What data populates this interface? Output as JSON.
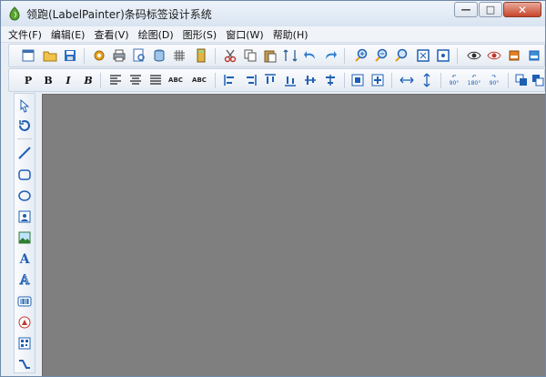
{
  "window": {
    "title": "领跑(LabelPainter)条码标签设计系统",
    "controls": {
      "minimize": "—",
      "maximize": "□",
      "close": "✕"
    }
  },
  "menu": [
    "文件(F)",
    "编辑(E)",
    "查看(V)",
    "绘图(D)",
    "图形(S)",
    "窗口(W)",
    "帮助(H)"
  ],
  "format_toolbar": {
    "plain": "P",
    "bold": "B",
    "italic": "I",
    "bold_italic": "B",
    "lower_upper": "ABC",
    "upper": "ABC",
    "rot90": "90°",
    "rot180": "180°",
    "rot90b": "90°"
  },
  "colors": {
    "canvas": "#7f7f7f",
    "accent": "#1e5fb3"
  }
}
